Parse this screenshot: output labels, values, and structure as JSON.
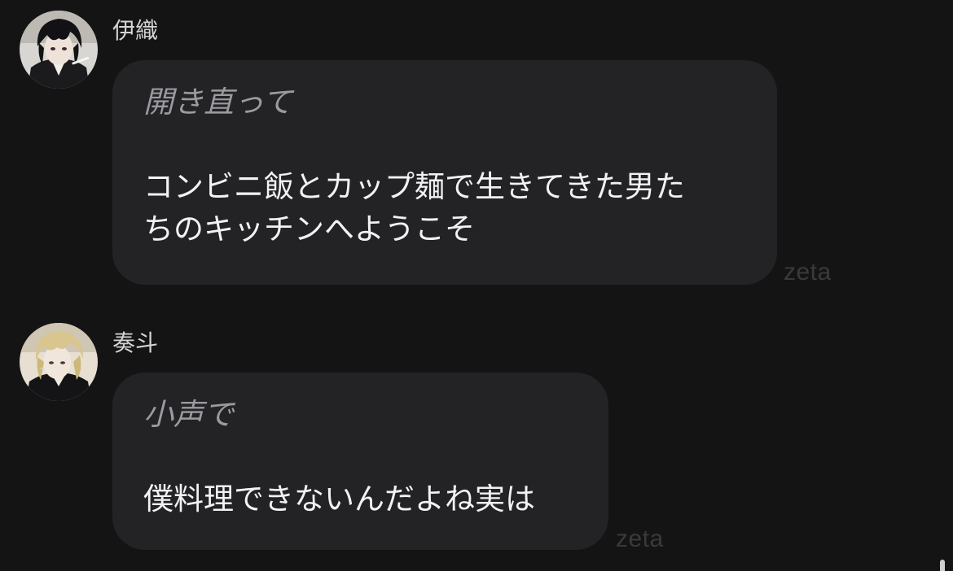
{
  "messages": [
    {
      "sender": "伊織",
      "action": "開き直って",
      "speech": "コンビニ飯とカップ麺で生きてきた男た\nちのキッチンへようこそ",
      "watermark": "zeta"
    },
    {
      "sender": "奏斗",
      "action": "小声で",
      "speech": "僕料理できないんだよね実は",
      "watermark": "zeta"
    }
  ],
  "colors": {
    "background": "#141415",
    "bubble": "#232326",
    "action_text": "#9a9aa0",
    "speech_text": "#f2f2f4"
  }
}
